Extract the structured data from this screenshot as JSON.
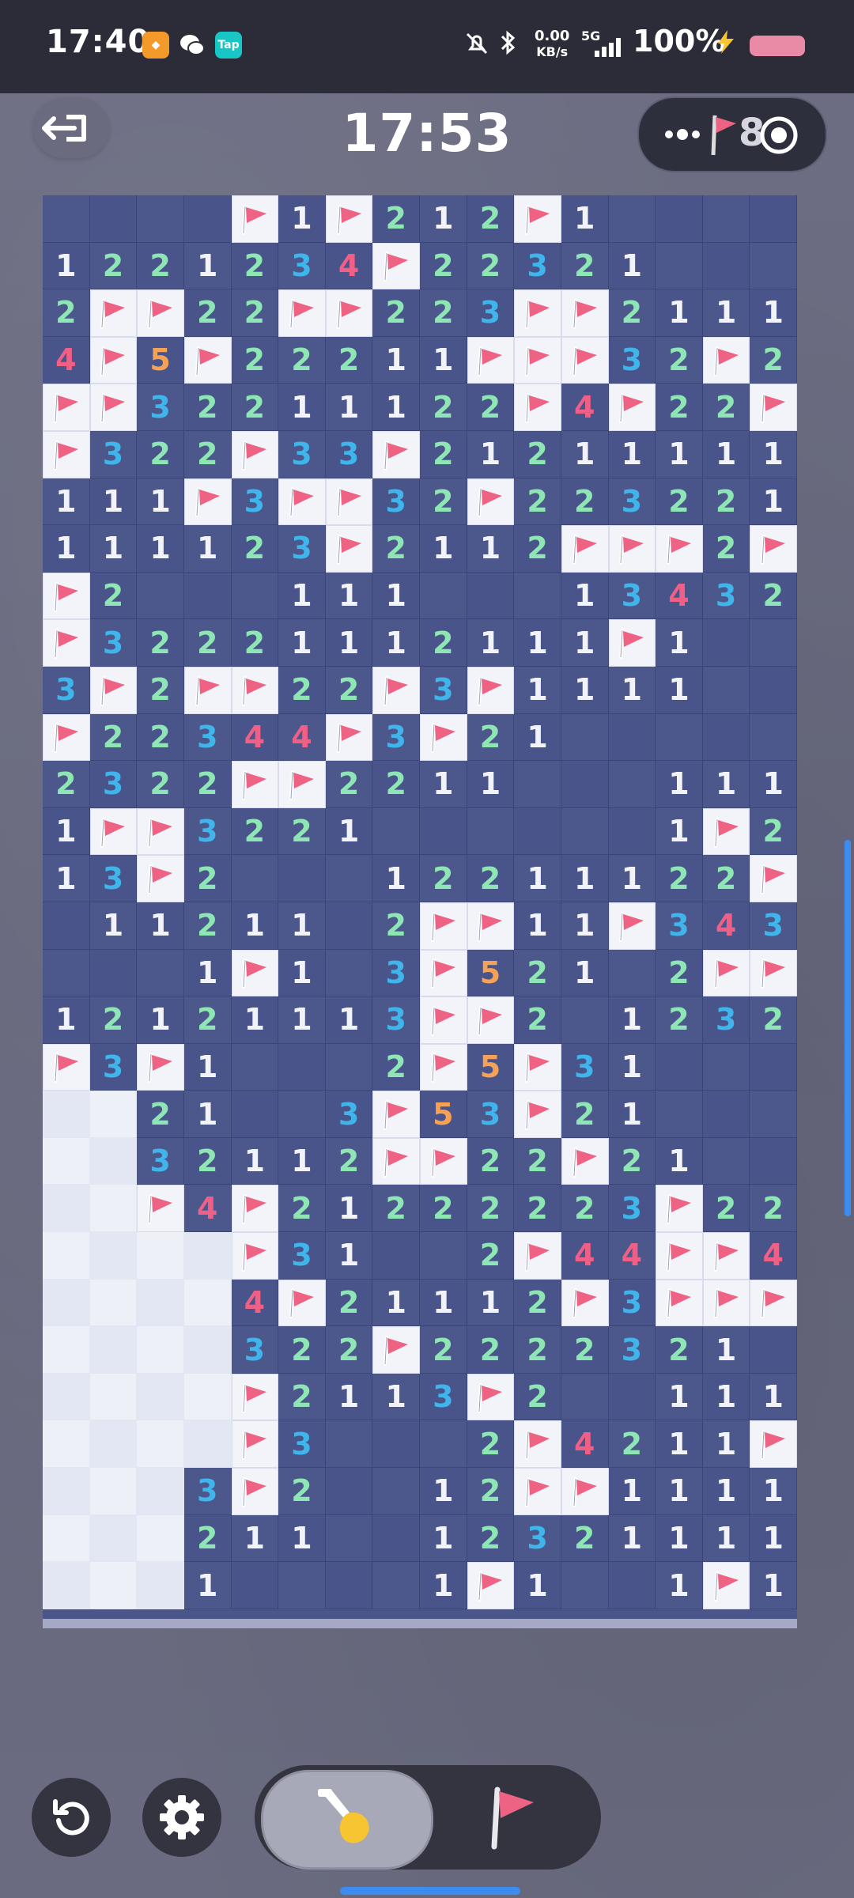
{
  "status_bar": {
    "time": "17:40",
    "app_icons": [
      "orange-app-icon",
      "wechat-icon",
      "taptap-icon"
    ],
    "taptap_label": "Tap",
    "net_speed_value": "0.00",
    "net_speed_unit": "KB/s",
    "network_type": "5G",
    "battery_percent": "100%",
    "icons": [
      "mute-icon",
      "bluetooth-icon",
      "signal-icon",
      "charging-icon",
      "battery-icon"
    ]
  },
  "game_header": {
    "exit_icon": "exit-icon",
    "timer": "17:53",
    "menu_icons": [
      "more-dots-icon",
      "flag-counter-icon",
      "target-icon"
    ],
    "flag_counter_digit": "8"
  },
  "board": {
    "columns": 16,
    "rows": 30,
    "legend": "F = flag, H = unrevealed, 0 = empty revealed, 1-5 = adjacent mine count",
    "cells": [
      "0000F1F212F10000",
      "1221234F22321000",
      "2FF22FF223FF2111",
      "4F5F22211FFF32F2",
      "FF32211122F4F22F2",
      "F322F33F21211111",
      "111F3FF32F223221",
      "11112 3F2112FFF2F",
      "F2000111000134321",
      "F32221112111F100",
      "3F2FF22F3F111100",
      "F2234 4F3F21000 0",
      "2322FF22110001110",
      "1FF3221000000 1F2",
      "13F2000122111 22F",
      "0112110 2FF11F343",
      "0001F103F52102FFF",
      "1212111 3FF20123 2",
      "F3F10002F5F31000",
      "HH21003F53F21000",
      "HH3211 2FF22F210",
      "HHF4F21222223F221",
      "HHHHF31002F44FF4F",
      "HHHH4F21112F3FFF2",
      "HHHH32 2F2222 3 21",
      "HHHHF211 3F200111",
      "HHHHF30002F421 1F1",
      "HHH3F20012FF1111",
      "HHH21100123 21111",
      "HHH10000 1F100 1F1"
    ]
  },
  "controls": {
    "reset_icon": "restart-icon",
    "settings_icon": "settings-icon",
    "modes": [
      {
        "name": "dig",
        "icon": "shovel-icon",
        "active": true
      },
      {
        "name": "flag",
        "icon": "flag-icon",
        "active": false
      }
    ]
  },
  "colors": {
    "number_1": "#f2f3f8",
    "number_2": "#8ee6b4",
    "number_3": "#3fb5ec",
    "number_4": "#ef5f86",
    "number_5": "#f6a256",
    "flag": "#ee6384",
    "board_open": "#4c588c",
    "board_hidden": "#eef0f8"
  }
}
